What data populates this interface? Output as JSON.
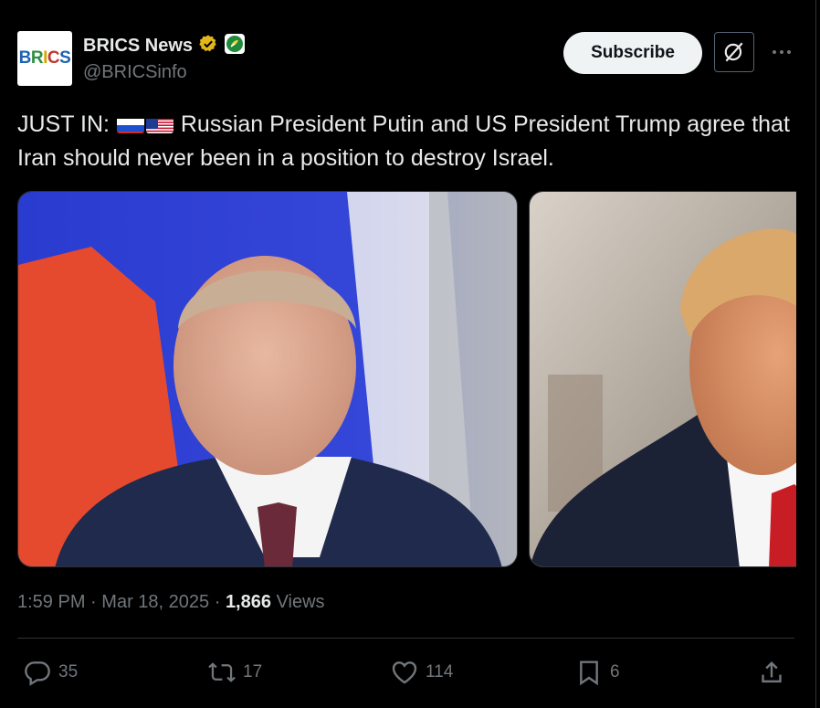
{
  "account": {
    "display_name": "BRICS News",
    "handle": "@BRICSinfo",
    "avatar_text": "BRICS",
    "verified_icon": "gold-verified-badge-icon",
    "affiliate_icon": "green-affiliate-badge-icon"
  },
  "header": {
    "subscribe_label": "Subscribe",
    "grok_icon": "grok-icon",
    "more_icon": "more-dots-icon"
  },
  "tweet": {
    "prefix": "JUST IN:",
    "flags": [
      "flag-russia-icon",
      "flag-usa-icon"
    ],
    "body": "Russian President Putin and US President Trump agree that Iran should never been in a position to destroy Israel."
  },
  "media": {
    "photos": [
      "photo-putin",
      "photo-trump"
    ]
  },
  "meta": {
    "time": "1:59 PM",
    "date": "Mar 18, 2025",
    "separator": "·",
    "views_count": "1,866",
    "views_label": "Views"
  },
  "actions": {
    "replies": "35",
    "reposts": "17",
    "likes": "114",
    "bookmarks": "6"
  },
  "colors": {
    "background": "#000000",
    "text": "#e7e9ea",
    "muted": "#71767b",
    "divider": "#2f3336",
    "subscribe_bg": "#eff3f4",
    "verified_gold": "#e2b719",
    "affiliate_green": "#00ba7c"
  }
}
